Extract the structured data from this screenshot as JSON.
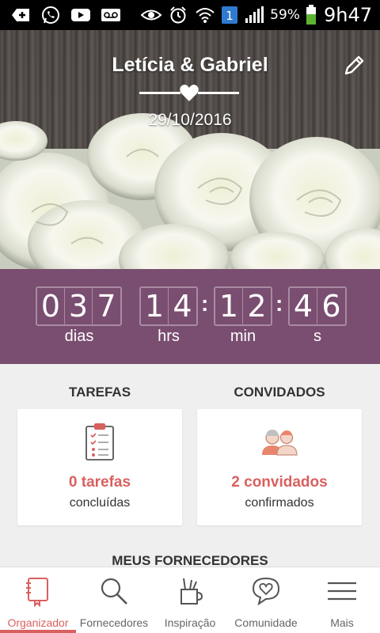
{
  "status_bar": {
    "battery_percent": "59%",
    "time": "9h47",
    "icons": [
      "add-box-icon",
      "whatsapp-icon",
      "youtube-icon",
      "voicemail-icon",
      "eye-icon",
      "alarm-icon",
      "wifi-icon",
      "sim-1-icon",
      "signal-icon",
      "battery-icon"
    ],
    "sim_label": "1"
  },
  "hero": {
    "couple_names": "Letícia & Gabriel",
    "wedding_date": "29/10/2016"
  },
  "countdown": {
    "days_digits": [
      "0",
      "3",
      "7"
    ],
    "hours_digits": [
      "1",
      "4"
    ],
    "minutes_digits": [
      "1",
      "2"
    ],
    "seconds_digits": [
      "4",
      "6"
    ],
    "separator": ":",
    "days_label": "dias",
    "hours_label": "hrs",
    "minutes_label": "min",
    "seconds_label": "s"
  },
  "tasks": {
    "title": "TAREFAS",
    "count": "0 tarefas",
    "subtitle": "concluídas"
  },
  "guests": {
    "title": "CONVIDADOS",
    "count": "2 convidados",
    "subtitle": "confirmados"
  },
  "providers": {
    "title": "MEUS FORNECEDORES"
  },
  "bottom_nav": {
    "items": [
      {
        "label": "Organizador",
        "icon": "notebook-icon",
        "active": true
      },
      {
        "label": "Fornecedores",
        "icon": "search-icon",
        "active": false
      },
      {
        "label": "Inspiração",
        "icon": "pencil-cup-icon",
        "active": false
      },
      {
        "label": "Comunidade",
        "icon": "chat-heart-icon",
        "active": false
      },
      {
        "label": "Mais",
        "icon": "menu-icon",
        "active": false
      }
    ]
  },
  "colors": {
    "accent": "#d9605f",
    "countdown_bg": "#7a4e70"
  }
}
